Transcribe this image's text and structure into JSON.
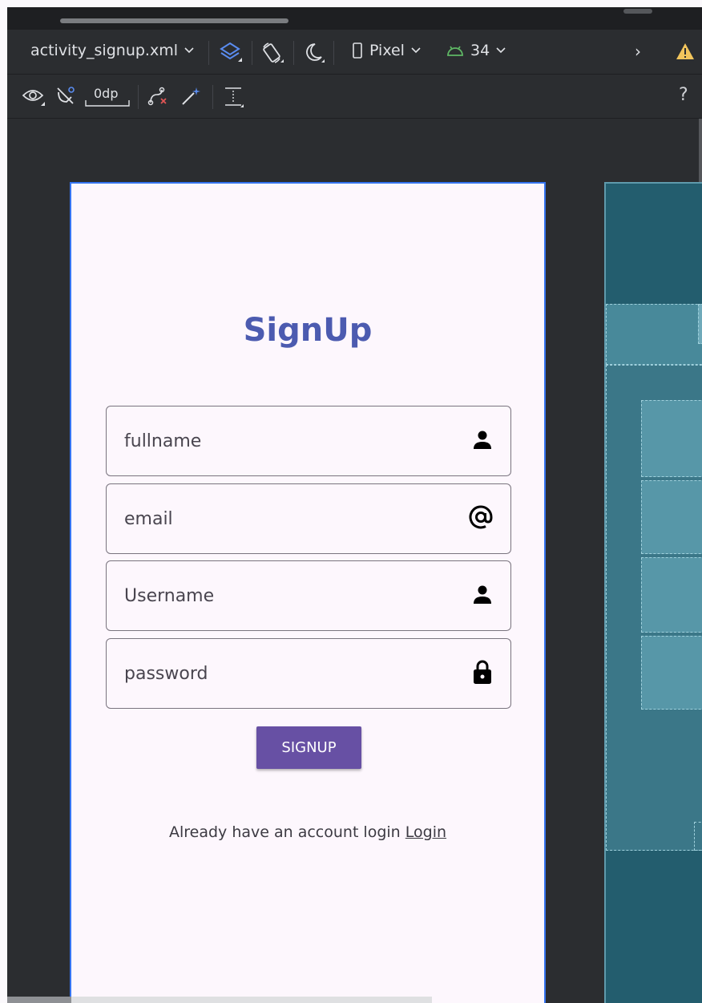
{
  "toolbar": {
    "file_name": "activity_signup.xml",
    "device": "Pixel",
    "api_level": "34",
    "margin": "0dp",
    "help": "?",
    "overflow": "›",
    "icons": [
      "layers-icon",
      "orientation-icon",
      "night-mode-icon",
      "device-icon",
      "android-icon",
      "warning-icon",
      "eye-icon",
      "magnet-off-icon",
      "clear-constraints-icon",
      "infer-constraints-icon",
      "guidelines-icon"
    ],
    "warning_color": "#f2c55c",
    "android_color": "#5fb865"
  },
  "screen": {
    "title": "SignUp",
    "title_color": "#4c5bb0",
    "fields": [
      {
        "placeholder": "fullname",
        "icon": "person-icon"
      },
      {
        "placeholder": "email",
        "icon": "at-icon"
      },
      {
        "placeholder": "Username",
        "icon": "person-icon"
      },
      {
        "placeholder": "password",
        "icon": "lock-icon"
      }
    ],
    "button_label": "SIGNUP",
    "button_color": "#6750a4",
    "footer_text": "Already have an account login ",
    "footer_link": "Login"
  }
}
